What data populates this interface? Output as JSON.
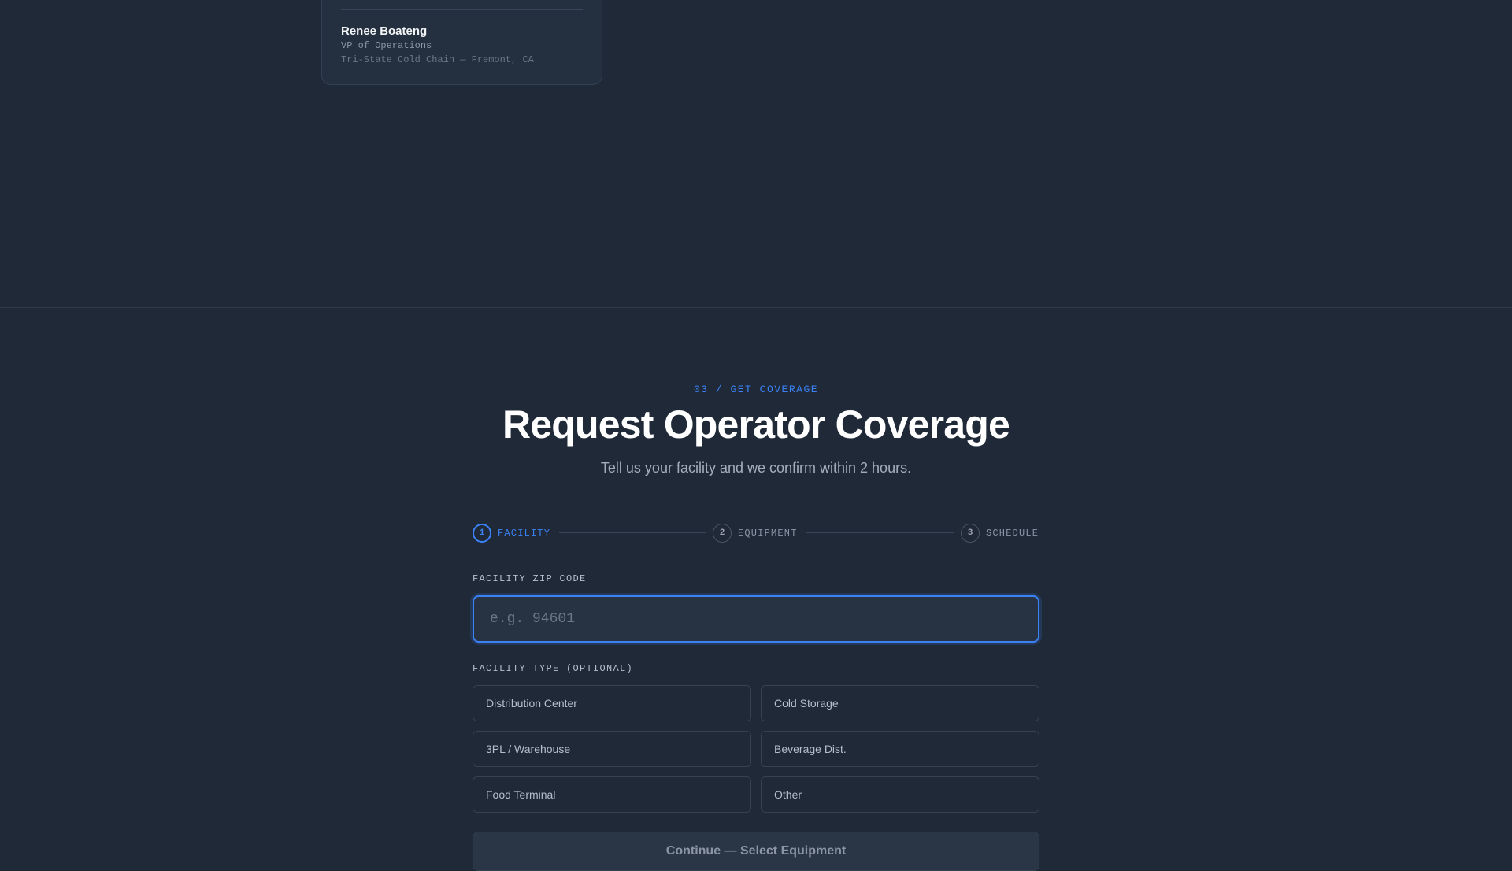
{
  "testimonial": {
    "name": "Renee Boateng",
    "role": "VP of Operations",
    "company": "Tri-State Cold Chain — Fremont, CA"
  },
  "coverage": {
    "eyebrow": "03 / GET COVERAGE",
    "title": "Request Operator Coverage",
    "subtitle": "Tell us your facility and we confirm within 2 hours."
  },
  "stepper": {
    "steps": [
      {
        "number": "1",
        "label": "FACILITY",
        "state": "active"
      },
      {
        "number": "2",
        "label": "EQUIPMENT",
        "state": "inactive"
      },
      {
        "number": "3",
        "label": "SCHEDULE",
        "state": "inactive"
      }
    ]
  },
  "form": {
    "zip_label": "FACILITY ZIP CODE",
    "zip_value": "",
    "zip_placeholder": "e.g. 94601",
    "type_label": "FACILITY TYPE (OPTIONAL)",
    "type_options": [
      "Distribution Center",
      "Cold Storage",
      "3PL / Warehouse",
      "Beverage Dist.",
      "Food Terminal",
      "Other"
    ],
    "continue_label": "Continue — Select Equipment"
  },
  "colors": {
    "background": "#1f2937",
    "accent": "#3b82f6",
    "card": "#243040"
  }
}
